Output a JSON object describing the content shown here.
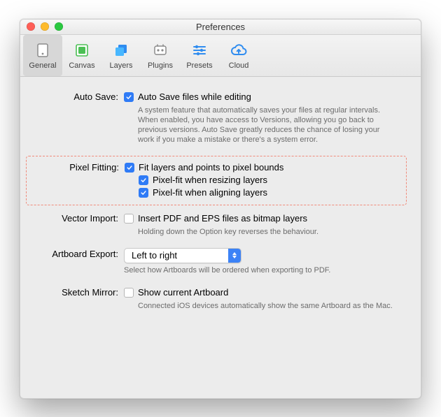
{
  "window": {
    "title": "Preferences"
  },
  "toolbar": {
    "tabs": [
      {
        "label": "General",
        "selected": true
      },
      {
        "label": "Canvas"
      },
      {
        "label": "Layers"
      },
      {
        "label": "Plugins"
      },
      {
        "label": "Presets"
      },
      {
        "label": "Cloud"
      }
    ]
  },
  "sections": {
    "autosave": {
      "label": "Auto Save:",
      "option": "Auto Save files while editing",
      "checked": true,
      "help": "A system feature that automatically saves your files at regular intervals. When enabled, you have access to Versions, allowing you go back to previous versions. Auto Save greatly reduces the chance of losing your work if you make a mistake or there's a system error."
    },
    "pixelfitting": {
      "label": "Pixel Fitting:",
      "option_bounds": "Fit layers and points to pixel bounds",
      "option_resize": "Pixel-fit when resizing layers",
      "option_align": "Pixel-fit when aligning layers",
      "checked_bounds": true,
      "checked_resize": true,
      "checked_align": true,
      "highlighted": true
    },
    "vectorimport": {
      "label": "Vector Import:",
      "option": "Insert PDF and EPS files as bitmap layers",
      "checked": false,
      "help": "Holding down the Option key reverses the behaviour."
    },
    "artboardexport": {
      "label": "Artboard Export:",
      "value": "Left to right",
      "help": "Select how Artboards will be ordered when exporting to PDF."
    },
    "sketchmirror": {
      "label": "Sketch Mirror:",
      "option": "Show current Artboard",
      "checked": false,
      "help": "Connected iOS devices automatically show the same Artboard as the Mac."
    }
  }
}
